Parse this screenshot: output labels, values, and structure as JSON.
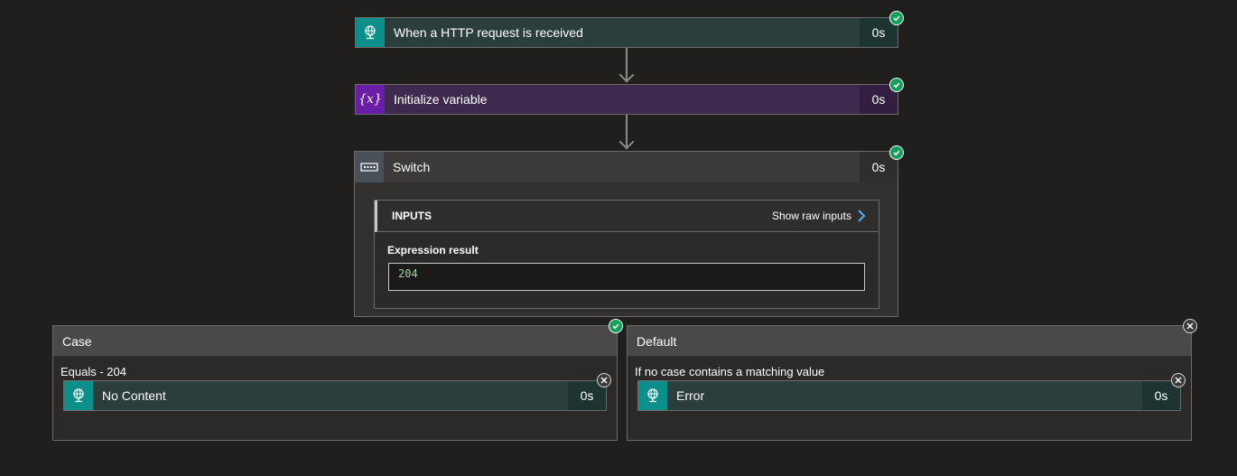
{
  "steps": {
    "trigger": {
      "title": "When a HTTP request is received",
      "duration": "0s",
      "icon": "globe-icon",
      "status": "success"
    },
    "init_var": {
      "title": "Initialize variable",
      "duration": "0s",
      "icon": "variable-icon",
      "icon_glyph": "{x}",
      "status": "success"
    },
    "switch": {
      "title": "Switch",
      "duration": "0s",
      "icon": "switch-icon",
      "status": "success",
      "inputs": {
        "title": "INPUTS",
        "show_raw": "Show raw inputs",
        "expression_label": "Expression result",
        "expression_value": "204"
      }
    }
  },
  "branches": {
    "case": {
      "title": "Case",
      "condition": "Equals - 204",
      "status": "success",
      "action": {
        "title": "No Content",
        "duration": "0s",
        "icon": "globe-icon"
      }
    },
    "default": {
      "title": "Default",
      "condition": "If no case contains a matching value",
      "status": "skipped",
      "action": {
        "title": "Error",
        "duration": "0s",
        "icon": "globe-icon"
      }
    }
  },
  "colors": {
    "background": "#201f1e",
    "teal": "#0b8f8a",
    "purple": "#6a1ea8",
    "success": "#139f5a"
  }
}
